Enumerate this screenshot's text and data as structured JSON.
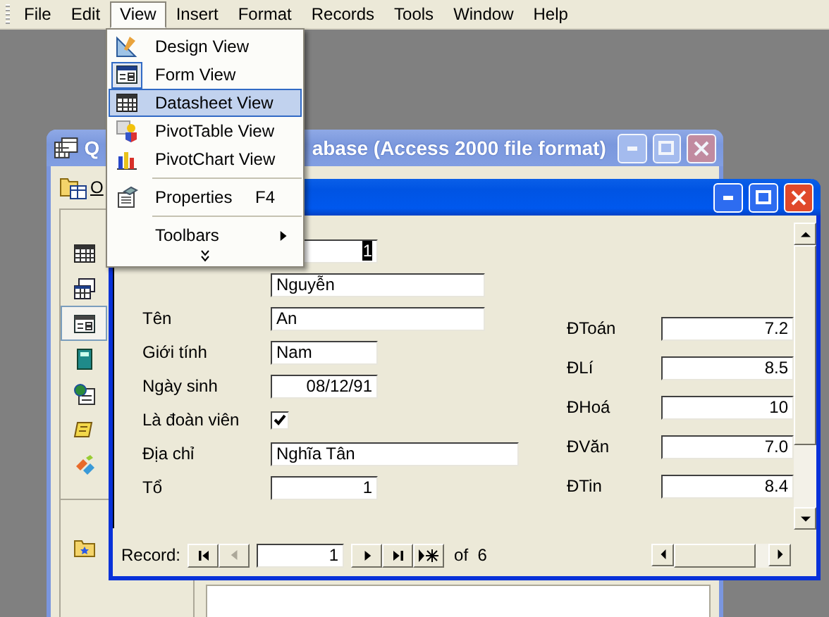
{
  "menu_bar": {
    "items": [
      {
        "label": "File",
        "selected": false
      },
      {
        "label": "Edit",
        "selected": false
      },
      {
        "label": "View",
        "selected": true
      },
      {
        "label": "Insert",
        "selected": false
      },
      {
        "label": "Format",
        "selected": false
      },
      {
        "label": "Records",
        "selected": false
      },
      {
        "label": "Tools",
        "selected": false
      },
      {
        "label": "Window",
        "selected": false
      },
      {
        "label": "Help",
        "selected": false
      }
    ]
  },
  "view_menu": {
    "items": [
      {
        "kind": "command",
        "label": "Design View",
        "checked": false,
        "selected": false
      },
      {
        "kind": "command",
        "label": "Form View",
        "checked": true,
        "selected": false
      },
      {
        "kind": "command",
        "label": "Datasheet View",
        "checked": false,
        "selected": true
      },
      {
        "kind": "command",
        "label": "PivotTable View",
        "checked": false,
        "selected": false
      },
      {
        "kind": "command",
        "label": "PivotChart View",
        "checked": false,
        "selected": false
      },
      {
        "kind": "separator"
      },
      {
        "kind": "command",
        "label": "Properties",
        "shortcut": "F4",
        "checked": false,
        "selected": false
      },
      {
        "kind": "separator"
      },
      {
        "kind": "submenu",
        "label": "Toolbars",
        "selected": false
      },
      {
        "kind": "expand"
      }
    ]
  },
  "database_window": {
    "title_parts": [
      "Q",
      "abase (Access 2000 file format)"
    ],
    "toolbar_label": "O",
    "objects": [
      {
        "kind": "table",
        "selected": false
      },
      {
        "kind": "query",
        "selected": false
      },
      {
        "kind": "form",
        "selected": true
      },
      {
        "kind": "report",
        "selected": false
      },
      {
        "kind": "page",
        "selected": false
      },
      {
        "kind": "macro",
        "selected": false
      },
      {
        "kind": "module",
        "selected": false
      },
      {
        "kind": "favorites",
        "selected": false
      }
    ]
  },
  "form_window": {
    "left_fields": [
      {
        "kind": "number",
        "value": "1",
        "selected": true
      },
      {
        "kind": "text",
        "value": "Nguyễn",
        "selected": false
      },
      {
        "kind": "text",
        "label": "Tên",
        "value": " An",
        "selected": false
      },
      {
        "kind": "text",
        "label": "Giới tính",
        "value": "Nam",
        "selected": false
      },
      {
        "kind": "date",
        "label": "Ngày sinh",
        "value": "08/12/91",
        "selected": false
      },
      {
        "kind": "checkbox",
        "label": "Là đoàn viên",
        "checked": true
      },
      {
        "kind": "text",
        "label": "Địa chỉ",
        "value": "Nghĩa Tân",
        "selected": false
      },
      {
        "kind": "number",
        "label": "Tổ",
        "value": "1",
        "selected": false
      }
    ],
    "right_fields": [
      {
        "label": "ĐToán",
        "value": "7.2"
      },
      {
        "label": "ĐLí",
        "value": "8.5"
      },
      {
        "label": "ĐHoá",
        "value": "10"
      },
      {
        "label": "ĐVăn",
        "value": "7.0"
      },
      {
        "label": "ĐTin",
        "value": "8.4"
      }
    ],
    "navigation": {
      "label": "Record:",
      "current": "1",
      "total": "of  6"
    }
  }
}
